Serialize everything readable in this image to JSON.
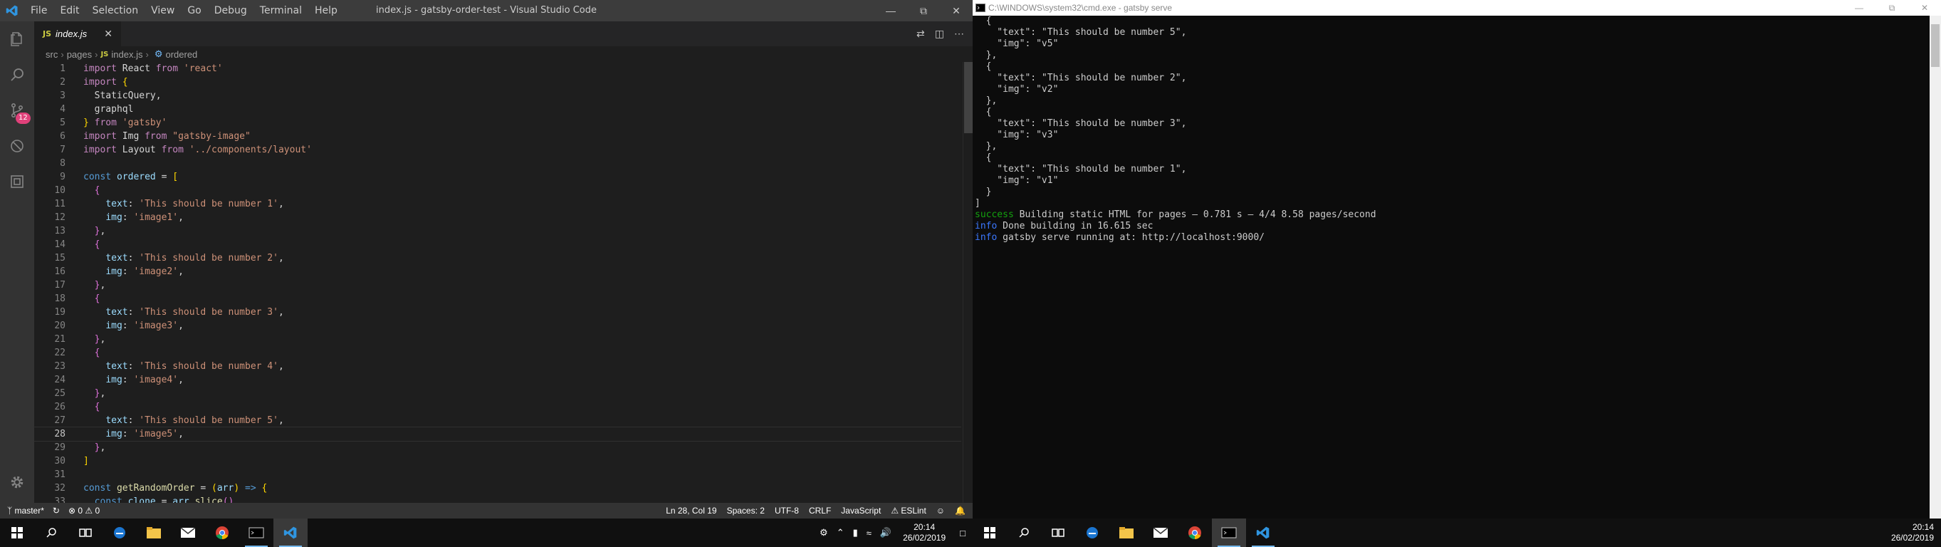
{
  "vscode": {
    "title": "index.js - gatsby-order-test - Visual Studio Code",
    "menu": [
      "File",
      "Edit",
      "Selection",
      "View",
      "Go",
      "Debug",
      "Terminal",
      "Help"
    ],
    "tab": {
      "label": "index.js",
      "type": "JS"
    },
    "breadcrumbs": [
      "src",
      "pages",
      "index.js",
      "ordered"
    ],
    "scm_badge": "12",
    "code": [
      [
        [
          "kw",
          "import"
        ],
        [
          "pun",
          " React "
        ],
        [
          "kw",
          "from"
        ],
        [
          "pun",
          " "
        ],
        [
          "str",
          "'react'"
        ]
      ],
      [
        [
          "kw",
          "import"
        ],
        [
          "pun",
          " "
        ],
        [
          "br1",
          "{"
        ]
      ],
      [
        [
          "pun",
          "  StaticQuery,"
        ]
      ],
      [
        [
          "pun",
          "  graphql"
        ]
      ],
      [
        [
          "br1",
          "}"
        ],
        [
          "pun",
          " "
        ],
        [
          "kw",
          "from"
        ],
        [
          "pun",
          " "
        ],
        [
          "str",
          "'gatsby'"
        ]
      ],
      [
        [
          "kw",
          "import"
        ],
        [
          "pun",
          " Img "
        ],
        [
          "kw",
          "from"
        ],
        [
          "pun",
          " "
        ],
        [
          "str",
          "\"gatsby-image\""
        ]
      ],
      [
        [
          "kw",
          "import"
        ],
        [
          "pun",
          " Layout "
        ],
        [
          "kw",
          "from"
        ],
        [
          "pun",
          " "
        ],
        [
          "str",
          "'../components/layout'"
        ]
      ],
      [],
      [
        [
          "kwb",
          "const"
        ],
        [
          "pun",
          " "
        ],
        [
          "var",
          "ordered"
        ],
        [
          "pun",
          " = "
        ],
        [
          "br1",
          "["
        ]
      ],
      [
        [
          "pun",
          "  "
        ],
        [
          "br2",
          "{"
        ]
      ],
      [
        [
          "pun",
          "    "
        ],
        [
          "prop",
          "text"
        ],
        [
          "pun",
          ": "
        ],
        [
          "str",
          "'This should be number 1'"
        ],
        [
          "pun",
          ","
        ]
      ],
      [
        [
          "pun",
          "    "
        ],
        [
          "prop",
          "img"
        ],
        [
          "pun",
          ": "
        ],
        [
          "str",
          "'image1'"
        ],
        [
          "pun",
          ","
        ]
      ],
      [
        [
          "pun",
          "  "
        ],
        [
          "br2",
          "}"
        ],
        [
          "pun",
          ","
        ]
      ],
      [
        [
          "pun",
          "  "
        ],
        [
          "br2",
          "{"
        ]
      ],
      [
        [
          "pun",
          "    "
        ],
        [
          "prop",
          "text"
        ],
        [
          "pun",
          ": "
        ],
        [
          "str",
          "'This should be number 2'"
        ],
        [
          "pun",
          ","
        ]
      ],
      [
        [
          "pun",
          "    "
        ],
        [
          "prop",
          "img"
        ],
        [
          "pun",
          ": "
        ],
        [
          "str",
          "'image2'"
        ],
        [
          "pun",
          ","
        ]
      ],
      [
        [
          "pun",
          "  "
        ],
        [
          "br2",
          "}"
        ],
        [
          "pun",
          ","
        ]
      ],
      [
        [
          "pun",
          "  "
        ],
        [
          "br2",
          "{"
        ]
      ],
      [
        [
          "pun",
          "    "
        ],
        [
          "prop",
          "text"
        ],
        [
          "pun",
          ": "
        ],
        [
          "str",
          "'This should be number 3'"
        ],
        [
          "pun",
          ","
        ]
      ],
      [
        [
          "pun",
          "    "
        ],
        [
          "prop",
          "img"
        ],
        [
          "pun",
          ": "
        ],
        [
          "str",
          "'image3'"
        ],
        [
          "pun",
          ","
        ]
      ],
      [
        [
          "pun",
          "  "
        ],
        [
          "br2",
          "}"
        ],
        [
          "pun",
          ","
        ]
      ],
      [
        [
          "pun",
          "  "
        ],
        [
          "br2",
          "{"
        ]
      ],
      [
        [
          "pun",
          "    "
        ],
        [
          "prop",
          "text"
        ],
        [
          "pun",
          ": "
        ],
        [
          "str",
          "'This should be number 4'"
        ],
        [
          "pun",
          ","
        ]
      ],
      [
        [
          "pun",
          "    "
        ],
        [
          "prop",
          "img"
        ],
        [
          "pun",
          ": "
        ],
        [
          "str",
          "'image4'"
        ],
        [
          "pun",
          ","
        ]
      ],
      [
        [
          "pun",
          "  "
        ],
        [
          "br2",
          "}"
        ],
        [
          "pun",
          ","
        ]
      ],
      [
        [
          "pun",
          "  "
        ],
        [
          "br2",
          "{"
        ]
      ],
      [
        [
          "pun",
          "    "
        ],
        [
          "prop",
          "text"
        ],
        [
          "pun",
          ": "
        ],
        [
          "str",
          "'This should be number 5'"
        ],
        [
          "pun",
          ","
        ]
      ],
      [
        [
          "pun",
          "    "
        ],
        [
          "prop",
          "img"
        ],
        [
          "pun",
          ": "
        ],
        [
          "str",
          "'image5'"
        ],
        [
          "pun",
          ","
        ]
      ],
      [
        [
          "pun",
          "  "
        ],
        [
          "br2",
          "}"
        ],
        [
          "pun",
          ","
        ]
      ],
      [
        [
          "br1",
          "]"
        ]
      ],
      [],
      [
        [
          "kwb",
          "const"
        ],
        [
          "pun",
          " "
        ],
        [
          "fn",
          "getRandomOrder"
        ],
        [
          "pun",
          " = "
        ],
        [
          "br1",
          "("
        ],
        [
          "var",
          "arr"
        ],
        [
          "br1",
          ")"
        ],
        [
          "pun",
          " "
        ],
        [
          "kwb",
          "=>"
        ],
        [
          "pun",
          " "
        ],
        [
          "br1",
          "{"
        ]
      ],
      [
        [
          "pun",
          "  "
        ],
        [
          "kwb",
          "const"
        ],
        [
          "pun",
          " "
        ],
        [
          "var",
          "clone"
        ],
        [
          "pun",
          " = "
        ],
        [
          "var",
          "arr"
        ],
        [
          "pun",
          "."
        ],
        [
          "fn",
          "slice"
        ],
        [
          "br2",
          "()"
        ]
      ]
    ],
    "current_line": 28,
    "status": {
      "branch": "master*",
      "errors": "0",
      "warnings": "0",
      "position": "Ln 28, Col 19",
      "spaces": "Spaces: 2",
      "encoding": "UTF-8",
      "eol": "CRLF",
      "language": "JavaScript",
      "linter": "ESLint"
    }
  },
  "cmd": {
    "title": "C:\\WINDOWS\\system32\\cmd.exe - gatsby  serve",
    "lines": [
      [
        [
          "",
          "  {"
        ]
      ],
      [
        [
          "",
          "    \"text\": \"This should be number 5\","
        ]
      ],
      [
        [
          "",
          "    \"img\": \"v5\""
        ]
      ],
      [
        [
          "",
          "  },"
        ]
      ],
      [
        [
          "",
          "  {"
        ]
      ],
      [
        [
          "",
          "    \"text\": \"This should be number 2\","
        ]
      ],
      [
        [
          "",
          "    \"img\": \"v2\""
        ]
      ],
      [
        [
          "",
          "  },"
        ]
      ],
      [
        [
          "",
          "  {"
        ]
      ],
      [
        [
          "",
          "    \"text\": \"This should be number 3\","
        ]
      ],
      [
        [
          "",
          "    \"img\": \"v3\""
        ]
      ],
      [
        [
          "",
          "  },"
        ]
      ],
      [
        [
          "",
          "  {"
        ]
      ],
      [
        [
          "",
          "    \"text\": \"This should be number 1\","
        ]
      ],
      [
        [
          "",
          "    \"img\": \"v1\""
        ]
      ],
      [
        [
          "",
          "  }"
        ]
      ],
      [
        [
          "",
          "]"
        ]
      ],
      [
        [
          "grn",
          "success"
        ],
        [
          "",
          " Building static HTML for pages — 0.781 s — 4/4 8.58 pages/second"
        ]
      ],
      [
        [
          "blu",
          "info"
        ],
        [
          "",
          " Done building in 16.615 sec"
        ]
      ],
      [
        [
          "blu",
          "info"
        ],
        [
          "",
          " gatsby serve running at: http://localhost:9000/"
        ]
      ]
    ]
  },
  "taskbar": {
    "time": "20:14",
    "date": "26/02/2019",
    "apps": [
      "start-icon",
      "search-icon",
      "task-view-icon",
      "edge-icon",
      "file-explorer-icon",
      "mail-icon",
      "chrome-icon",
      "cmd-icon",
      "vscode-icon"
    ]
  }
}
